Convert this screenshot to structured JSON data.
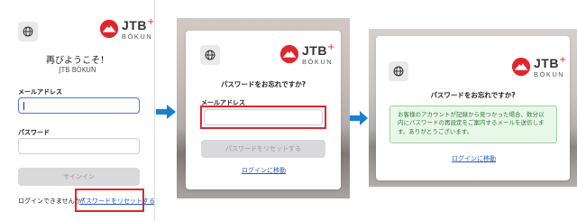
{
  "screen1": {
    "title": "再びようこそ！",
    "subtitle": "JTB BÓKUN",
    "email_label": "メールアドレス",
    "password_label": "パスワード",
    "signin_button": "サインイン",
    "cant_login_text": "ログインできませんか？",
    "reset_link": "パスワードをリセットする"
  },
  "screen2": {
    "title": "パスワードをお忘れですか?",
    "email_label": "メールアドレス",
    "reset_button": "パスワードをリセットする",
    "login_link": "ログインに移動"
  },
  "screen3": {
    "title": "パスワードをお忘れですか?",
    "notice": "お客様のアカウントが記録から見つかった場合、数分以内にパスワードの再設定をご案内するメールを送信します。ありがとうございます。",
    "login_link": "ログインに移動"
  },
  "brand": {
    "jtb": "JTB",
    "plus": "+",
    "bokun": "BÓKUN",
    "accent_color": "#e0262d",
    "arrow_color": "#1a7fd0"
  },
  "icons": [
    "globe-icon",
    "jtb-bokun-logo",
    "arrow-right-icon"
  ]
}
